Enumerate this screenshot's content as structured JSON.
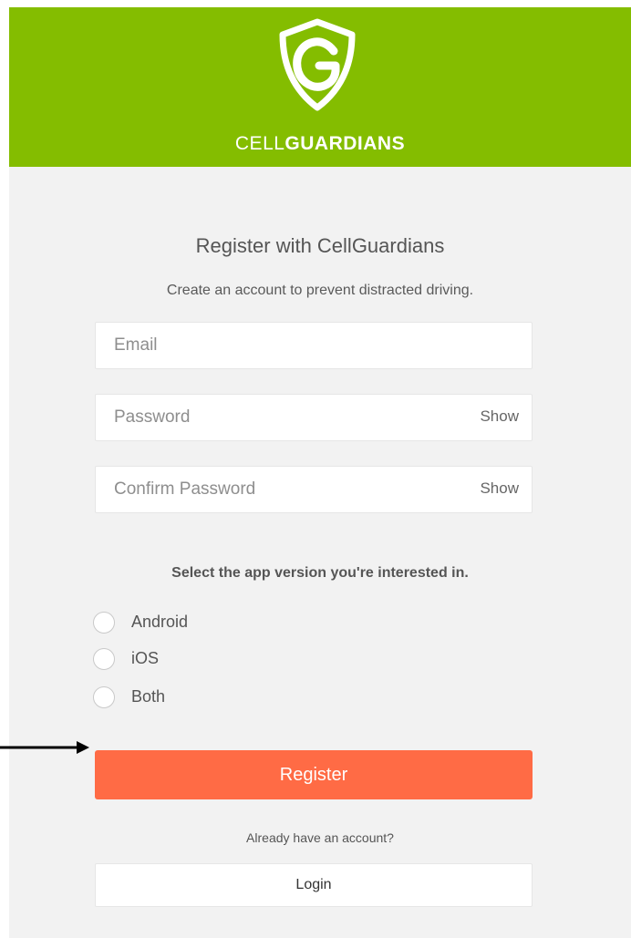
{
  "header": {
    "brand_light": "CELL",
    "brand_bold": "GUARDIANS",
    "logo_icon": "shield-g-logo-icon",
    "background_color": "#84bd00"
  },
  "form": {
    "title": "Register with CellGuardians",
    "subtitle": "Create an account to prevent distracted driving.",
    "email_placeholder": "Email",
    "password_placeholder": "Password",
    "confirm_placeholder": "Confirm Password",
    "show_label": "Show",
    "version_prompt": "Select the app version you're interested in.",
    "versions": [
      "Android",
      "iOS",
      "Both"
    ],
    "register_label": "Register",
    "register_color": "#ff6b45",
    "already_label": "Already have an account?",
    "login_label": "Login"
  }
}
